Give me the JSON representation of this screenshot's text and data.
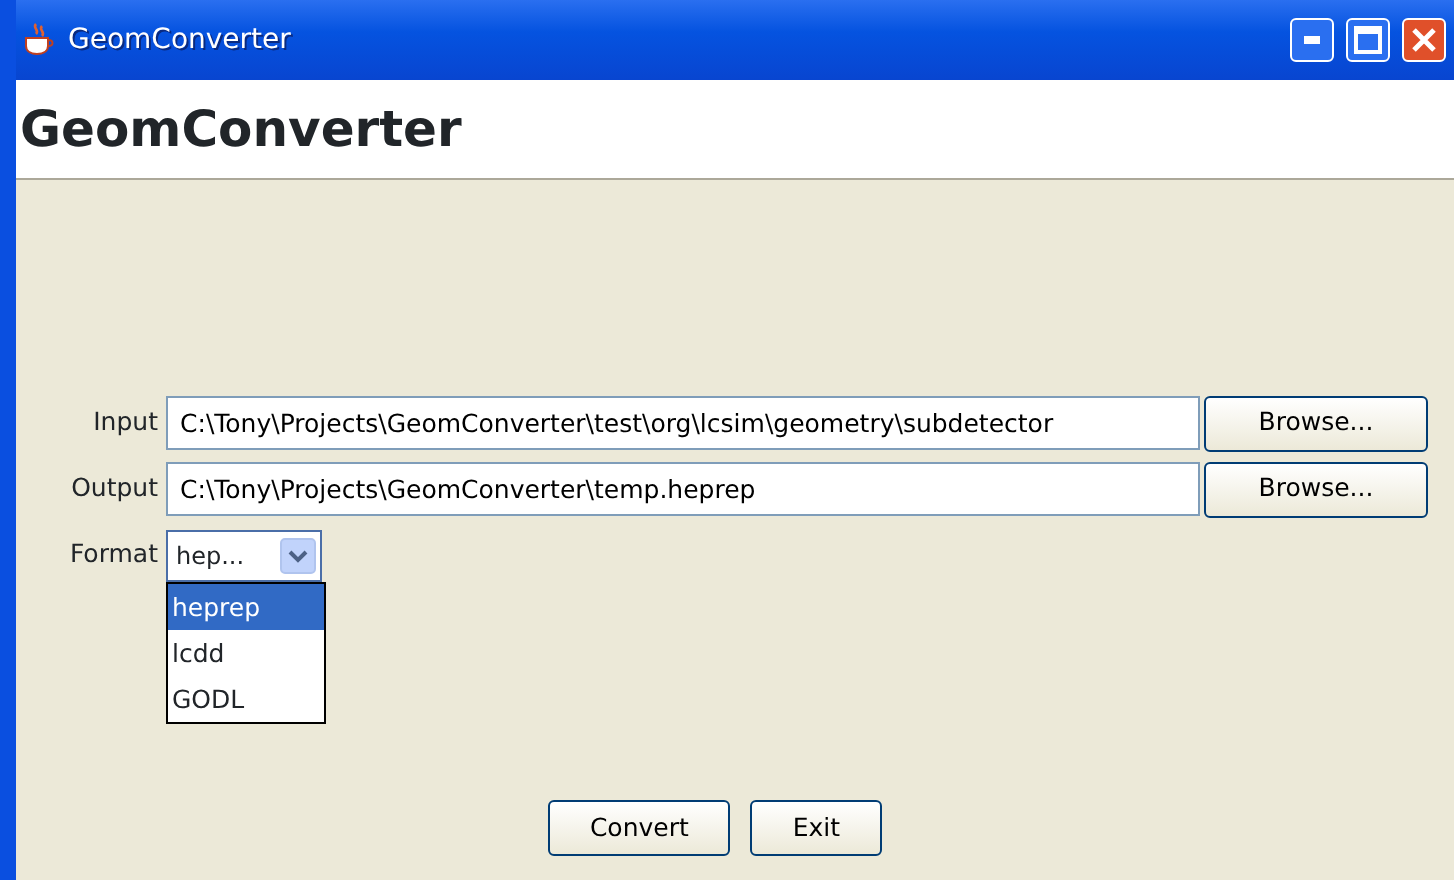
{
  "window": {
    "title": "GeomConverter"
  },
  "header": {
    "title": "GeomConverter"
  },
  "fields": [
    {
      "label": "Input",
      "value": "C:\\Tony\\Projects\\GeomConverter\\test\\org\\lcsim\\geometry\\subdetector",
      "button": "Browse..."
    },
    {
      "label": "Output",
      "value": "C:\\Tony\\Projects\\GeomConverter\\temp.heprep",
      "button": "Browse..."
    }
  ],
  "format": {
    "label": "Format",
    "value": "hep...",
    "expanded": true,
    "options": [
      {
        "label": "heprep",
        "selected": true
      },
      {
        "label": "lcdd",
        "selected": false
      },
      {
        "label": "GODL",
        "selected": false
      }
    ]
  },
  "buttons": [
    "Convert",
    "Exit"
  ]
}
